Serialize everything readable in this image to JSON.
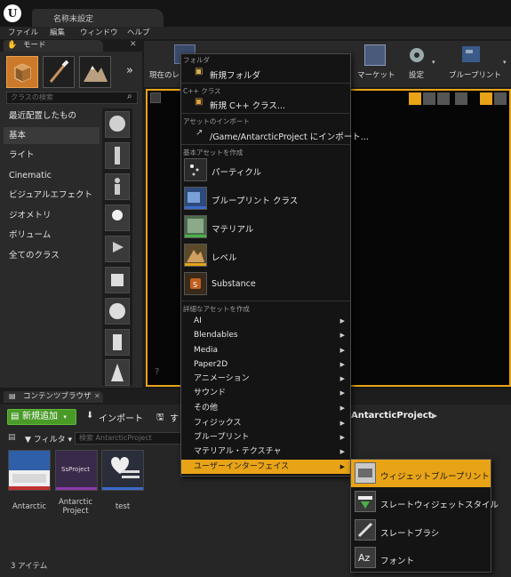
{
  "window": {
    "doc_tab": "名称未設定"
  },
  "menubar": [
    "ファイル",
    "編集",
    "ウィンドウ",
    "ヘルプ"
  ],
  "modes": {
    "tab_label": "モード",
    "search_placeholder": "クラスの検索",
    "categories": [
      "最近配置したもの",
      "基本",
      "ライト",
      "Cinematic",
      "ビジュアルエフェクト",
      "ジオメトリ",
      "ボリューム",
      "全てのクラス"
    ],
    "active_category": "基本"
  },
  "toolbar": {
    "current_level_label": "現在のレ",
    "marketplace_label": "マーケット",
    "settings_label": "設定",
    "blueprint_label": "ブループリント"
  },
  "content_browser": {
    "tab_label": "コンテンツブラウザ",
    "add_new": "新規追加",
    "import": "インポート",
    "save_partial": "す",
    "filter": "フィルタ",
    "search_placeholder": "検索 AntarcticProject",
    "path_label": "AntarcticProject",
    "assets": [
      {
        "label": "Antarctic"
      },
      {
        "label": "Antarctic Project",
        "thumb_text": "SsProject"
      },
      {
        "label": "test"
      }
    ],
    "item_count": "3 アイテム"
  },
  "context_menu": {
    "folder_header": "フォルダ",
    "new_folder": "新規フォルダ",
    "cpp_header": "C++ クラス",
    "new_cpp": "新規 C++ クラス...",
    "import_header": "アセットのインポート",
    "import_path": "/Game/AntarcticProject にインポート...",
    "basic_header": "基本アセットを作成",
    "basic_assets": [
      "パーティクル",
      "ブループリント クラス",
      "マテリアル",
      "レベル",
      "Substance"
    ],
    "advanced_header": "詳細なアセットを作成",
    "advanced_items": [
      "AI",
      "Blendables",
      "Media",
      "Paper2D",
      "アニメーション",
      "サウンド",
      "その他",
      "フィジックス",
      "ブループリント",
      "マテリアル・テクスチャ",
      "ユーザーインターフェイス"
    ]
  },
  "submenu": {
    "items": [
      "ウィジェットブループリント",
      "スレートウィジェットスタイル",
      "スレートブラシ",
      "フォント"
    ]
  },
  "colors": {
    "accent": "#e8a317",
    "add_button": "#4a9a28",
    "mode_active": "#cc7a2a"
  }
}
